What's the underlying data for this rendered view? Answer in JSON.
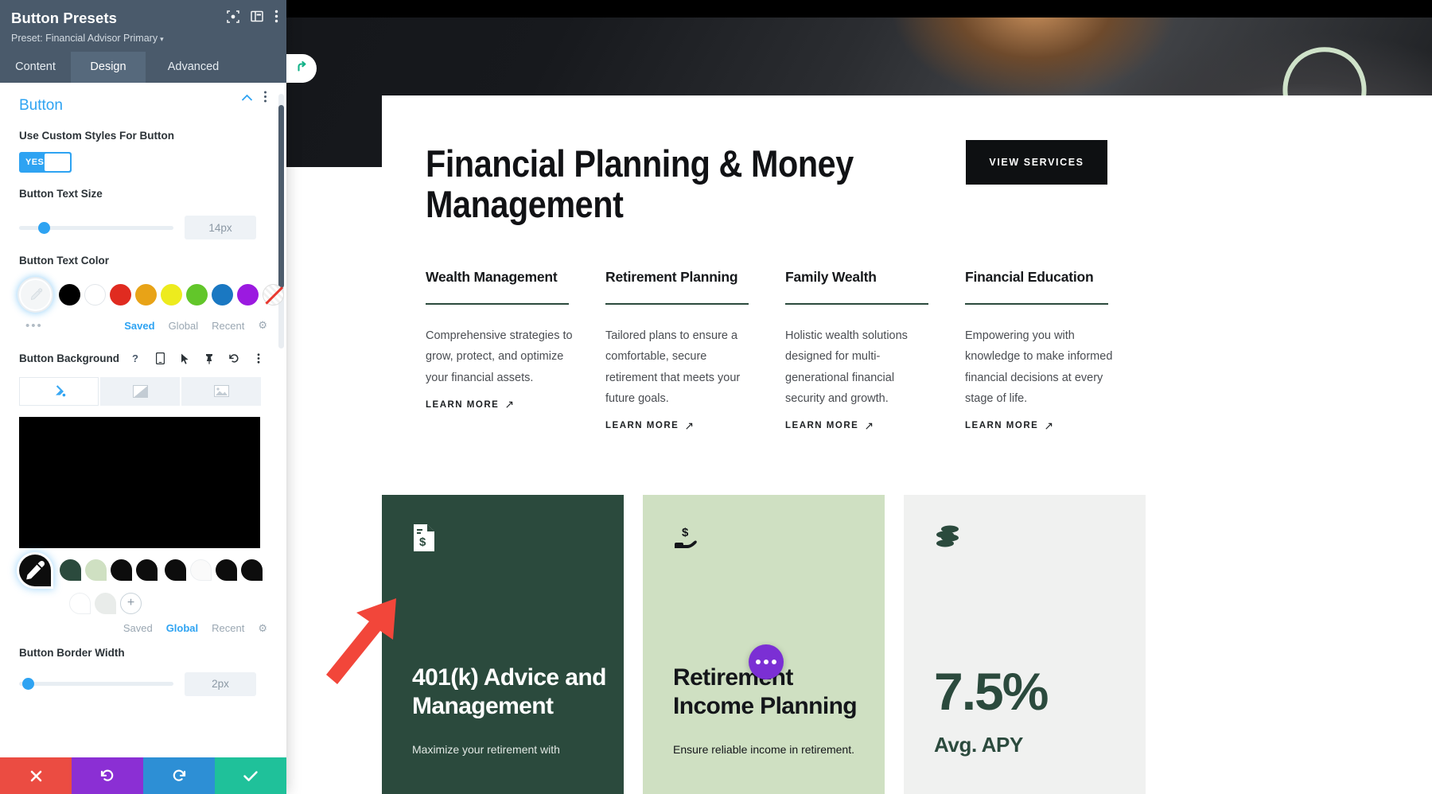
{
  "panel": {
    "title": "Button Presets",
    "preset_label": "Preset: Financial Advisor Primary",
    "caret": "▾",
    "header_icons": [
      {
        "name": "focus-icon",
        "glyph": "◙"
      },
      {
        "name": "layout-icon",
        "glyph": "▣"
      },
      {
        "name": "more-vertical-icon",
        "glyph": "⋮"
      }
    ],
    "tabs": [
      {
        "label": "Content",
        "active": false
      },
      {
        "label": "Design",
        "active": true
      },
      {
        "label": "Advanced",
        "active": false
      }
    ],
    "section": {
      "title": "Button",
      "collapse_icon": "^",
      "more_icon": "⋮"
    },
    "custom_styles": {
      "label": "Use Custom Styles For Button",
      "toggle_value": "YES"
    },
    "text_size": {
      "label": "Button Text Size",
      "value": "14px",
      "slider_percent": 13
    },
    "text_color": {
      "label": "Button Text Color",
      "swatches": [
        "#000000",
        "#ffffff",
        "#e02b20",
        "#e8a317",
        "#edeb1e",
        "#62c62a",
        "#1a78c2",
        "#9b1ae0"
      ],
      "none_label": "none",
      "ellipsis": "•••",
      "modes": [
        {
          "label": "Saved",
          "active": true
        },
        {
          "label": "Global",
          "active": false
        },
        {
          "label": "Recent",
          "active": false
        }
      ],
      "gear": "⚙"
    },
    "background": {
      "label": "Button Background",
      "icons": [
        {
          "name": "help-icon",
          "glyph": "?"
        },
        {
          "name": "responsive-icon",
          "glyph": "▯"
        },
        {
          "name": "hover-cursor-icon",
          "glyph": "➤"
        },
        {
          "name": "pin-icon",
          "glyph": "⚲"
        },
        {
          "name": "reset-icon",
          "glyph": "↺"
        },
        {
          "name": "more-vertical-icon",
          "glyph": "⋮"
        }
      ],
      "type_tabs": [
        {
          "name": "bg-solid-tab",
          "glyph": "◪",
          "active": true
        },
        {
          "name": "bg-gradient-tab",
          "glyph": "◩",
          "active": false
        },
        {
          "name": "bg-image-tab",
          "glyph": "▤",
          "active": false
        }
      ],
      "preview_color": "#000000",
      "palette": [
        "#2b4a3d",
        "#cfe0c2",
        "#0d0d0d",
        "#0d0d0d",
        "#0d0d0d",
        "#f7f7f7",
        "#0d0d0d",
        "#0d0d0d",
        "#ffffff",
        "#e9ecea"
      ],
      "add_glyph": "+",
      "modes": [
        {
          "label": "Saved",
          "active": false
        },
        {
          "label": "Global",
          "active": true
        },
        {
          "label": "Recent",
          "active": false
        }
      ],
      "gear": "⚙"
    },
    "border_width": {
      "label": "Button Border Width",
      "value": "2px"
    },
    "footer": [
      {
        "name": "cancel-button",
        "glyph": "✕",
        "color": "#eb4c42"
      },
      {
        "name": "undo-button",
        "glyph": "↺",
        "color": "#8b2fd4"
      },
      {
        "name": "redo-button",
        "glyph": "↻",
        "color": "#2d8fd5"
      },
      {
        "name": "save-button",
        "glyph": "✓",
        "color": "#1fc19a"
      }
    ]
  },
  "page": {
    "hero": {
      "heading": "Financial Planning & Money Management",
      "cta_label": "VIEW SERVICES",
      "tab_icon": "↱"
    },
    "features": [
      {
        "title": "Wealth Management",
        "body": "Comprehensive strategies to grow, protect, and optimize your financial assets.",
        "link": "LEARN MORE",
        "arrow": "↗"
      },
      {
        "title": "Retirement Planning",
        "body": "Tailored plans to ensure a comfortable, secure retirement that meets your future goals.",
        "link": "LEARN MORE",
        "arrow": "↗"
      },
      {
        "title": "Family Wealth",
        "body": "Holistic wealth solutions designed for multi-generational financial security and growth.",
        "link": "LEARN MORE",
        "arrow": "↗"
      },
      {
        "title": "Financial Education",
        "body": "Empowering you with knowledge to make informed financial decisions at every stage of life.",
        "link": "LEARN MORE",
        "arrow": "↗"
      }
    ],
    "cards": [
      {
        "icon": "document-dollar-icon",
        "title": "401(k) Advice and Management",
        "sub": "Maximize your retirement with",
        "bg": "#2b4a3d"
      },
      {
        "icon": "hand-dollar-icon",
        "title": "Retirement Income Planning",
        "sub": "Ensure reliable income in retirement.",
        "bg": "#cfe0c2"
      },
      {
        "icon": "coins-stack-icon",
        "stat": "7.5%",
        "stat_label": "Avg. APY",
        "bg": "#f0f1f0"
      }
    ]
  }
}
